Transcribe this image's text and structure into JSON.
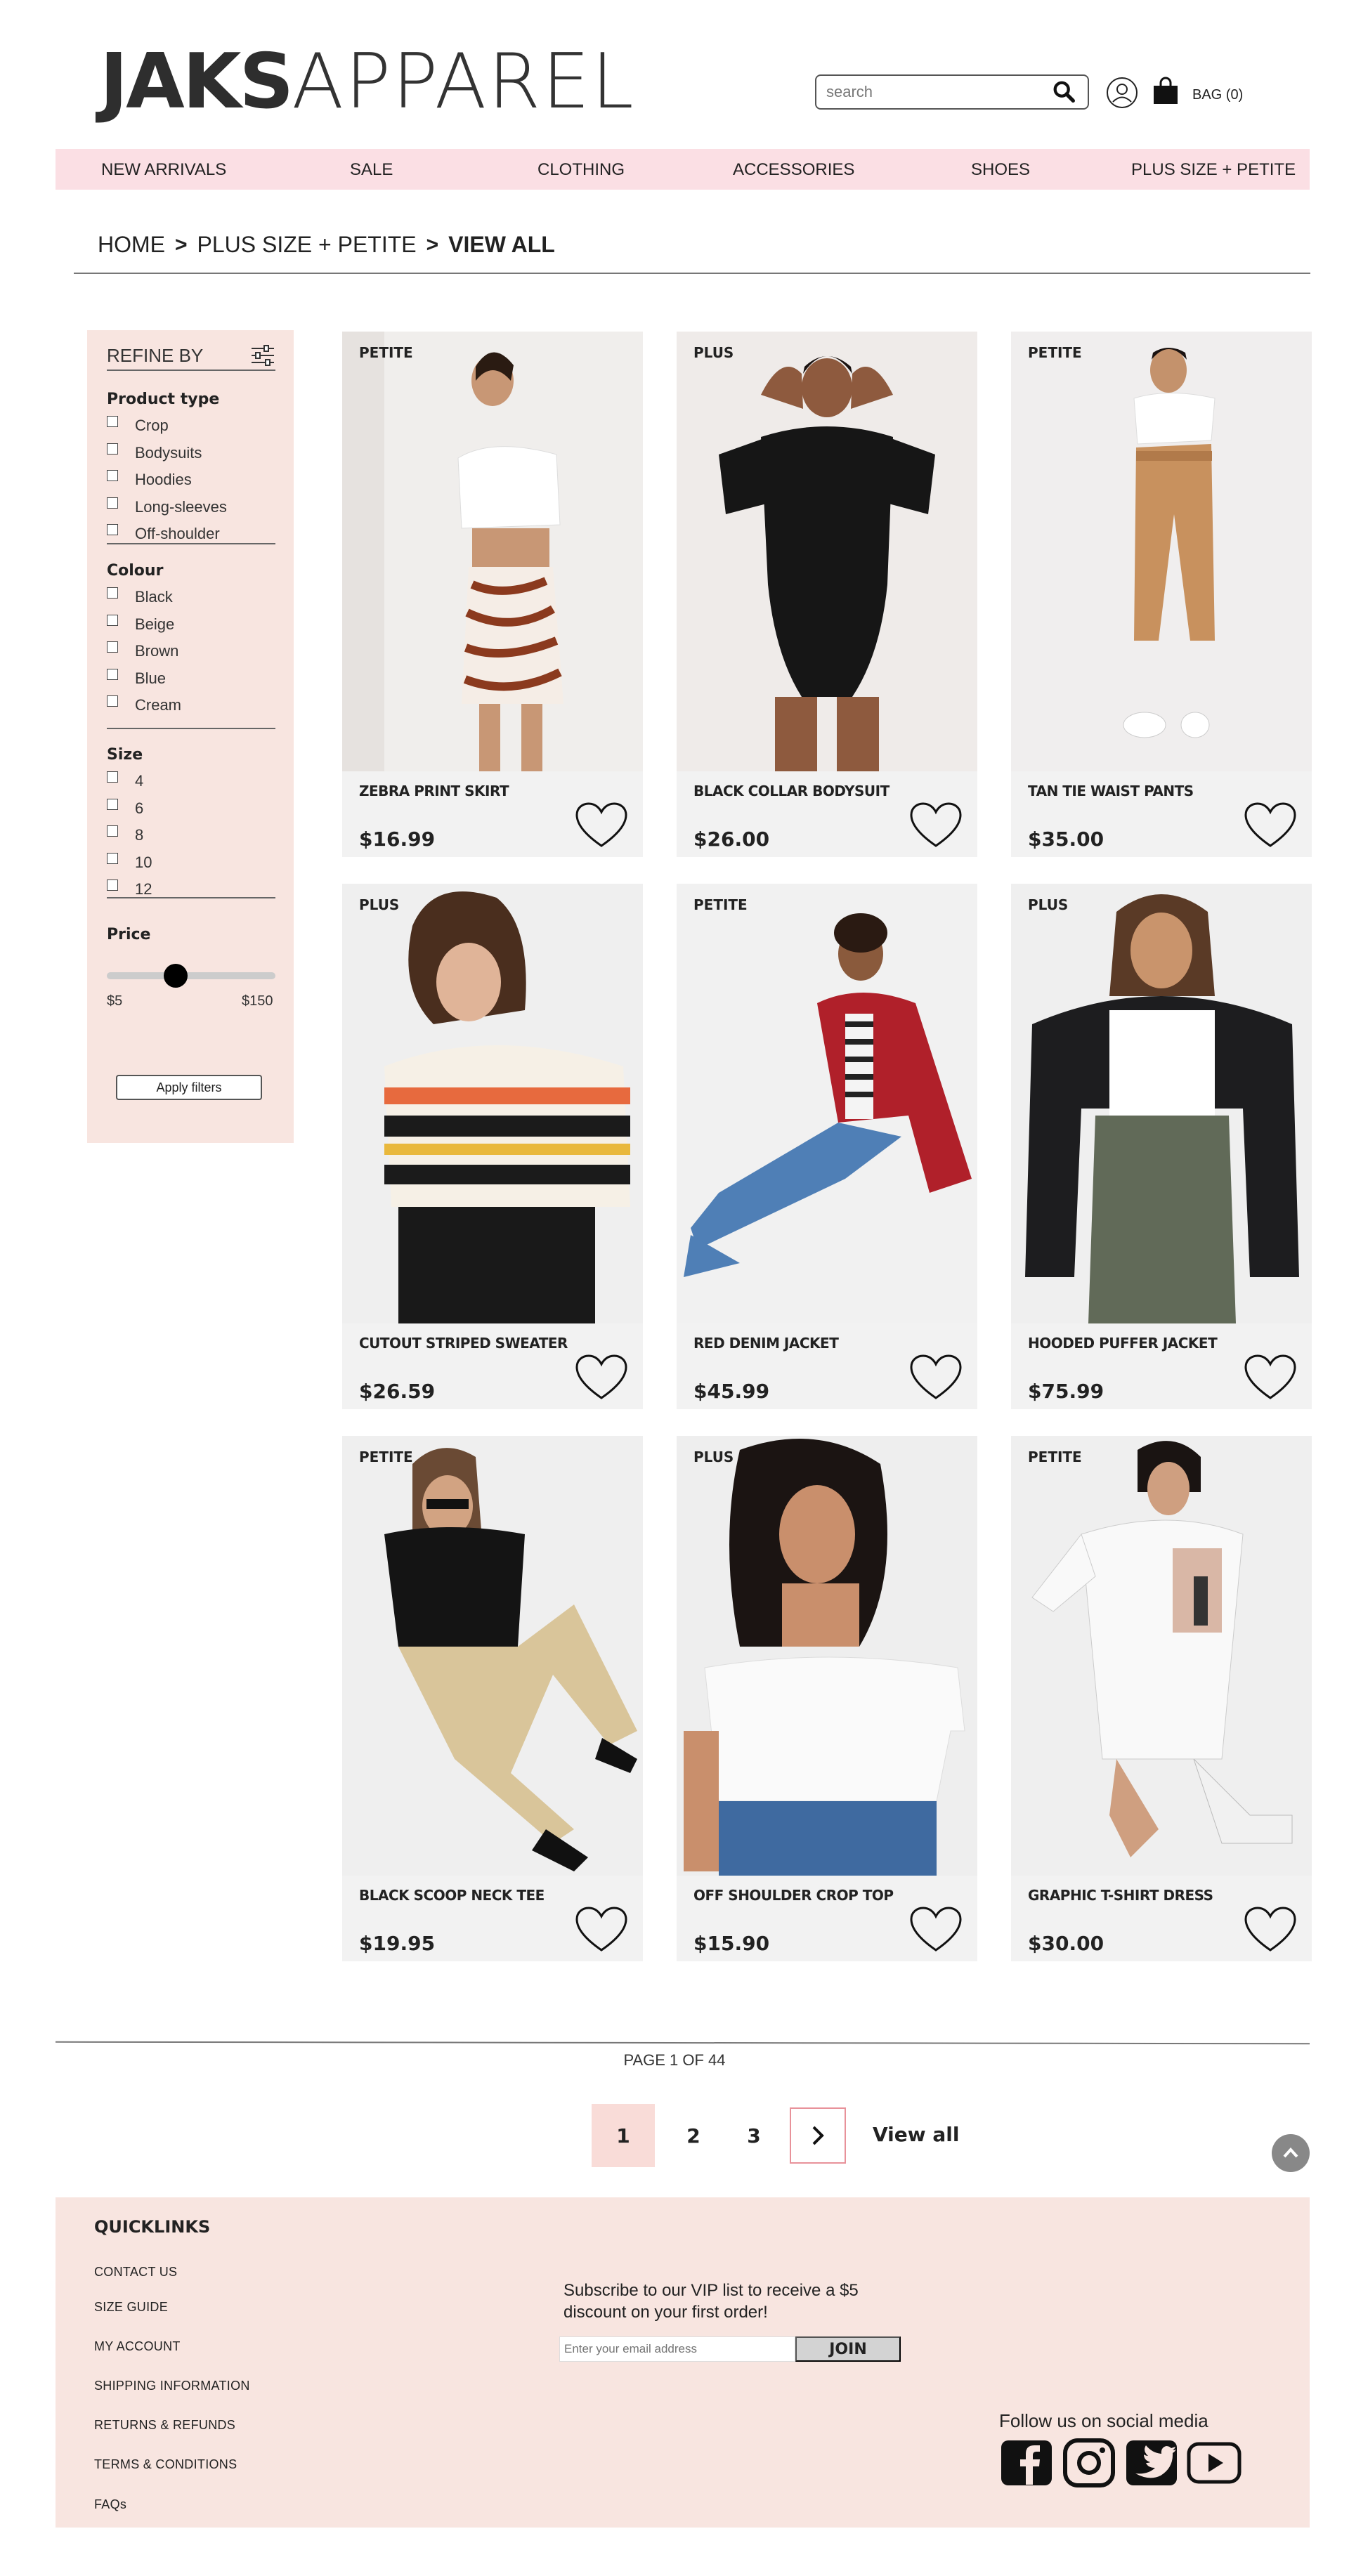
{
  "header": {
    "logo_bold": "JAKS",
    "logo_light": "APPAREL",
    "search_placeholder": "search",
    "bag_label": "BAG (0)"
  },
  "nav": {
    "items": [
      "NEW ARRIVALS",
      "SALE",
      "CLOTHING",
      "ACCESSORIES",
      "SHOES",
      "PLUS SIZE + PETITE"
    ]
  },
  "breadcrumb": {
    "home": "HOME",
    "section": "PLUS SIZE + PETITE",
    "current": "VIEW ALL",
    "separator": ">"
  },
  "sidebar": {
    "title": "REFINE BY",
    "product_type": {
      "heading": "Product type",
      "options": [
        "Crop",
        "Bodysuits",
        "Hoodies",
        "Long-sleeves",
        "Off-shoulder"
      ]
    },
    "colour": {
      "heading": "Colour",
      "options": [
        "Black",
        "Beige",
        "Brown",
        "Blue",
        "Cream"
      ]
    },
    "size": {
      "heading": "Size",
      "options": [
        "4",
        "6",
        "8",
        "10",
        "12"
      ]
    },
    "price": {
      "heading": "Price",
      "min_label": "$5",
      "max_label": "$150",
      "slider_value_fraction": 0.41
    },
    "apply_label": "Apply filters"
  },
  "products": [
    {
      "tag": "PETITE",
      "name": "ZEBRA PRINT SKIRT",
      "price": "$16.99"
    },
    {
      "tag": "PLUS",
      "name": "BLACK COLLAR BODYSUIT",
      "price": "$26.00"
    },
    {
      "tag": "PETITE",
      "name": "TAN TIE WAIST PANTS",
      "price": "$35.00"
    },
    {
      "tag": "PLUS",
      "name": "CUTOUT STRIPED SWEATER",
      "price": "$26.59"
    },
    {
      "tag": "PETITE",
      "name": "RED DENIM JACKET",
      "price": "$45.99"
    },
    {
      "tag": "PLUS",
      "name": "HOODED PUFFER JACKET",
      "price": "$75.99"
    },
    {
      "tag": "PETITE",
      "name": "BLACK SCOOP NECK TEE",
      "price": "$19.95"
    },
    {
      "tag": "PLUS",
      "name": "OFF SHOULDER CROP TOP",
      "price": "$15.90"
    },
    {
      "tag": "PETITE",
      "name": "GRAPHIC T-SHIRT DRESS",
      "price": "$30.00"
    }
  ],
  "pagination": {
    "page_count_text": "PAGE 1 OF 44",
    "pages": [
      "1",
      "2",
      "3"
    ],
    "next_icon": "chevron-right-icon",
    "view_all": "View all"
  },
  "footer": {
    "quicklinks_title": "QUICKLINKS",
    "links": [
      "CONTACT US",
      "SIZE GUIDE",
      "MY ACCOUNT",
      "SHIPPING INFORMATION",
      "RETURNS & REFUNDS",
      "TERMS & CONDITIONS",
      "FAQs"
    ],
    "subscribe_text": "Subscribe to our VIP list to receive a $5 discount on your first order!",
    "email_placeholder": "Enter your email address",
    "join_label": "JOIN",
    "social_title": "Follow us on social media",
    "social_icons": [
      "facebook-icon",
      "instagram-icon",
      "twitter-icon",
      "youtube-icon"
    ]
  },
  "colors": {
    "nav_bg": "#fbdfe4",
    "sidebar_bg": "#f8e5e0",
    "footer_bg": "#f8e5e0",
    "active_page_bg": "#f9dcd8",
    "next_border": "#e8929a"
  }
}
